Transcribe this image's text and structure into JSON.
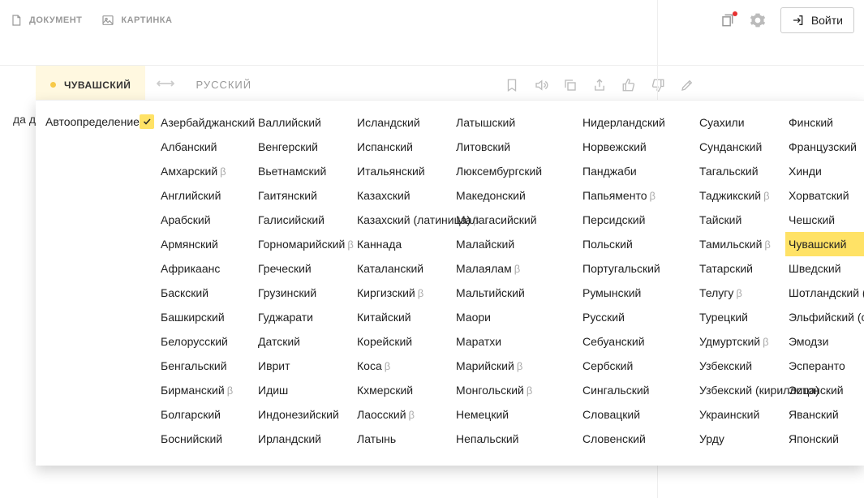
{
  "topNav": {
    "document": "ДОКУМЕНТ",
    "image": "КАРТИНКА",
    "login": "Войти"
  },
  "translateBar": {
    "srcLang": "ЧУВАШСКИЙ",
    "destLang": "РУССКИЙ"
  },
  "truncated": "да д",
  "dropdown": {
    "autoDetect": "Автоопределение",
    "columns": [
      [
        {
          "name": "Азербайджанский"
        },
        {
          "name": "Албанский"
        },
        {
          "name": "Амхарский",
          "beta": true
        },
        {
          "name": "Английский"
        },
        {
          "name": "Арабский"
        },
        {
          "name": "Армянский"
        },
        {
          "name": "Африкаанс"
        },
        {
          "name": "Баскский"
        },
        {
          "name": "Башкирский"
        },
        {
          "name": "Белорусский"
        },
        {
          "name": "Бенгальский"
        },
        {
          "name": "Бирманский",
          "beta": true
        },
        {
          "name": "Болгарский"
        },
        {
          "name": "Боснийский"
        }
      ],
      [
        {
          "name": "Валлийский"
        },
        {
          "name": "Венгерский"
        },
        {
          "name": "Вьетнамский"
        },
        {
          "name": "Гаитянский"
        },
        {
          "name": "Галисийский"
        },
        {
          "name": "Горномарийский",
          "beta": true
        },
        {
          "name": "Греческий"
        },
        {
          "name": "Грузинский"
        },
        {
          "name": "Гуджарати"
        },
        {
          "name": "Датский"
        },
        {
          "name": "Иврит"
        },
        {
          "name": "Идиш"
        },
        {
          "name": "Индонезийский"
        },
        {
          "name": "Ирландский"
        }
      ],
      [
        {
          "name": "Исландский"
        },
        {
          "name": "Испанский"
        },
        {
          "name": "Итальянский"
        },
        {
          "name": "Казахский"
        },
        {
          "name": "Казахский (латиница)",
          "beta": true
        },
        {
          "name": "Каннада"
        },
        {
          "name": "Каталанский"
        },
        {
          "name": "Киргизский",
          "beta": true
        },
        {
          "name": "Китайский"
        },
        {
          "name": "Корейский"
        },
        {
          "name": "Коса",
          "beta": true
        },
        {
          "name": "Кхмерский"
        },
        {
          "name": "Лаосский",
          "beta": true
        },
        {
          "name": "Латынь"
        }
      ],
      [
        {
          "name": "Латышский"
        },
        {
          "name": "Литовский"
        },
        {
          "name": "Люксембургский"
        },
        {
          "name": "Македонский"
        },
        {
          "name": "Малагасийский"
        },
        {
          "name": "Малайский"
        },
        {
          "name": "Малаялам",
          "beta": true
        },
        {
          "name": "Мальтийский"
        },
        {
          "name": "Маори"
        },
        {
          "name": "Маратхи"
        },
        {
          "name": "Марийский",
          "beta": true
        },
        {
          "name": "Монгольский",
          "beta": true
        },
        {
          "name": "Немецкий"
        },
        {
          "name": "Непальский"
        }
      ],
      [
        {
          "name": "Нидерландский"
        },
        {
          "name": "Норвежский"
        },
        {
          "name": "Панджаби"
        },
        {
          "name": "Папьяменто",
          "beta": true
        },
        {
          "name": "Персидский"
        },
        {
          "name": "Польский"
        },
        {
          "name": "Португальский"
        },
        {
          "name": "Румынский"
        },
        {
          "name": "Русский"
        },
        {
          "name": "Себуанский"
        },
        {
          "name": "Сербский"
        },
        {
          "name": "Сингальский"
        },
        {
          "name": "Словацкий"
        },
        {
          "name": "Словенский"
        }
      ],
      [
        {
          "name": "Суахили"
        },
        {
          "name": "Сунданский"
        },
        {
          "name": "Тагальский"
        },
        {
          "name": "Таджикский",
          "beta": true
        },
        {
          "name": "Тайский"
        },
        {
          "name": "Тамильский",
          "beta": true
        },
        {
          "name": "Татарский"
        },
        {
          "name": "Телугу",
          "beta": true
        },
        {
          "name": "Турецкий"
        },
        {
          "name": "Удмуртский",
          "beta": true
        },
        {
          "name": "Узбекский"
        },
        {
          "name": "Узбекский (кириллица)"
        },
        {
          "name": "Украинский"
        },
        {
          "name": "Урду"
        }
      ],
      [
        {
          "name": "Финский"
        },
        {
          "name": "Французский"
        },
        {
          "name": "Хинди"
        },
        {
          "name": "Хорватский"
        },
        {
          "name": "Чешский"
        },
        {
          "name": "Чувашский",
          "selected": true
        },
        {
          "name": "Шведский"
        },
        {
          "name": "Шотландский (гэльский)"
        },
        {
          "name": "Эльфийский (синдарин)"
        },
        {
          "name": "Эмодзи"
        },
        {
          "name": "Эсперанто"
        },
        {
          "name": "Эстонский"
        },
        {
          "name": "Яванский"
        },
        {
          "name": "Японский"
        }
      ]
    ]
  }
}
